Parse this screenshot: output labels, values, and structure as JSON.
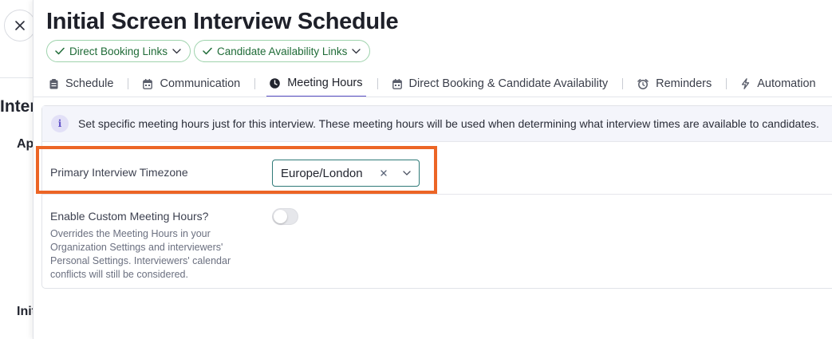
{
  "background": {
    "heading_partial": "Inter",
    "section_partial": "Ap",
    "footer_partial": "Init"
  },
  "drawer": {
    "title": "Initial Screen Interview Schedule",
    "pills": [
      {
        "label": "Direct Booking Links",
        "icon": "check-icon"
      },
      {
        "label": "Candidate Availability Links",
        "icon": "check-icon"
      }
    ],
    "tabs": [
      {
        "label": "Schedule",
        "icon": "clipboard-icon"
      },
      {
        "label": "Communication",
        "icon": "calendar-icon"
      },
      {
        "label": "Meeting Hours",
        "icon": "clock-icon",
        "active": true
      },
      {
        "label": "Direct Booking & Candidate Availability",
        "icon": "calendar-icon"
      },
      {
        "label": "Reminders",
        "icon": "alarm-clock-icon"
      },
      {
        "label": "Automation",
        "icon": "lightning-icon"
      }
    ],
    "info_banner": {
      "icon_glyph": "i",
      "text": "Set specific meeting hours just for this interview. These meeting hours will be used when determining what interview times are available to candidates."
    },
    "timezone": {
      "label": "Primary Interview Timezone",
      "value": "Europe/London"
    },
    "custom_hours": {
      "label": "Enable Custom Meeting Hours?",
      "help": "Overrides the Meeting Hours in your Organization Settings and interviewers' Personal Settings. Interviewers' calendar conflicts will still be considered.",
      "enabled": false
    }
  },
  "colors": {
    "accent": "#5b4fc5",
    "highlight": "#ec6525",
    "success": "#1f6b37",
    "select_border": "#2f7a78"
  }
}
